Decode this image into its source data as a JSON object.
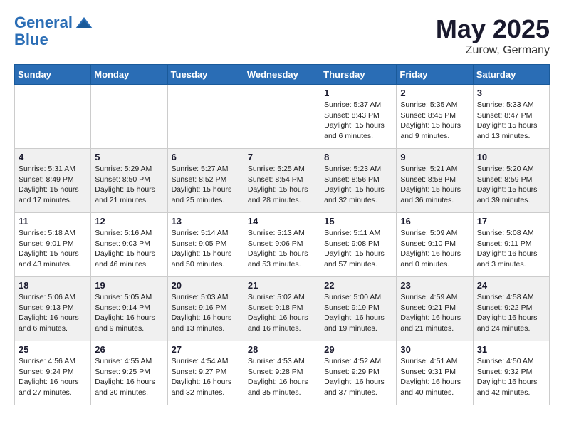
{
  "header": {
    "logo_line1": "General",
    "logo_line2": "Blue",
    "month": "May 2025",
    "location": "Zurow, Germany"
  },
  "weekdays": [
    "Sunday",
    "Monday",
    "Tuesday",
    "Wednesday",
    "Thursday",
    "Friday",
    "Saturday"
  ],
  "weeks": [
    [
      {
        "day": "",
        "info": ""
      },
      {
        "day": "",
        "info": ""
      },
      {
        "day": "",
        "info": ""
      },
      {
        "day": "",
        "info": ""
      },
      {
        "day": "1",
        "info": "Sunrise: 5:37 AM\nSunset: 8:43 PM\nDaylight: 15 hours\nand 6 minutes."
      },
      {
        "day": "2",
        "info": "Sunrise: 5:35 AM\nSunset: 8:45 PM\nDaylight: 15 hours\nand 9 minutes."
      },
      {
        "day": "3",
        "info": "Sunrise: 5:33 AM\nSunset: 8:47 PM\nDaylight: 15 hours\nand 13 minutes."
      }
    ],
    [
      {
        "day": "4",
        "info": "Sunrise: 5:31 AM\nSunset: 8:49 PM\nDaylight: 15 hours\nand 17 minutes."
      },
      {
        "day": "5",
        "info": "Sunrise: 5:29 AM\nSunset: 8:50 PM\nDaylight: 15 hours\nand 21 minutes."
      },
      {
        "day": "6",
        "info": "Sunrise: 5:27 AM\nSunset: 8:52 PM\nDaylight: 15 hours\nand 25 minutes."
      },
      {
        "day": "7",
        "info": "Sunrise: 5:25 AM\nSunset: 8:54 PM\nDaylight: 15 hours\nand 28 minutes."
      },
      {
        "day": "8",
        "info": "Sunrise: 5:23 AM\nSunset: 8:56 PM\nDaylight: 15 hours\nand 32 minutes."
      },
      {
        "day": "9",
        "info": "Sunrise: 5:21 AM\nSunset: 8:58 PM\nDaylight: 15 hours\nand 36 minutes."
      },
      {
        "day": "10",
        "info": "Sunrise: 5:20 AM\nSunset: 8:59 PM\nDaylight: 15 hours\nand 39 minutes."
      }
    ],
    [
      {
        "day": "11",
        "info": "Sunrise: 5:18 AM\nSunset: 9:01 PM\nDaylight: 15 hours\nand 43 minutes."
      },
      {
        "day": "12",
        "info": "Sunrise: 5:16 AM\nSunset: 9:03 PM\nDaylight: 15 hours\nand 46 minutes."
      },
      {
        "day": "13",
        "info": "Sunrise: 5:14 AM\nSunset: 9:05 PM\nDaylight: 15 hours\nand 50 minutes."
      },
      {
        "day": "14",
        "info": "Sunrise: 5:13 AM\nSunset: 9:06 PM\nDaylight: 15 hours\nand 53 minutes."
      },
      {
        "day": "15",
        "info": "Sunrise: 5:11 AM\nSunset: 9:08 PM\nDaylight: 15 hours\nand 57 minutes."
      },
      {
        "day": "16",
        "info": "Sunrise: 5:09 AM\nSunset: 9:10 PM\nDaylight: 16 hours\nand 0 minutes."
      },
      {
        "day": "17",
        "info": "Sunrise: 5:08 AM\nSunset: 9:11 PM\nDaylight: 16 hours\nand 3 minutes."
      }
    ],
    [
      {
        "day": "18",
        "info": "Sunrise: 5:06 AM\nSunset: 9:13 PM\nDaylight: 16 hours\nand 6 minutes."
      },
      {
        "day": "19",
        "info": "Sunrise: 5:05 AM\nSunset: 9:14 PM\nDaylight: 16 hours\nand 9 minutes."
      },
      {
        "day": "20",
        "info": "Sunrise: 5:03 AM\nSunset: 9:16 PM\nDaylight: 16 hours\nand 13 minutes."
      },
      {
        "day": "21",
        "info": "Sunrise: 5:02 AM\nSunset: 9:18 PM\nDaylight: 16 hours\nand 16 minutes."
      },
      {
        "day": "22",
        "info": "Sunrise: 5:00 AM\nSunset: 9:19 PM\nDaylight: 16 hours\nand 19 minutes."
      },
      {
        "day": "23",
        "info": "Sunrise: 4:59 AM\nSunset: 9:21 PM\nDaylight: 16 hours\nand 21 minutes."
      },
      {
        "day": "24",
        "info": "Sunrise: 4:58 AM\nSunset: 9:22 PM\nDaylight: 16 hours\nand 24 minutes."
      }
    ],
    [
      {
        "day": "25",
        "info": "Sunrise: 4:56 AM\nSunset: 9:24 PM\nDaylight: 16 hours\nand 27 minutes."
      },
      {
        "day": "26",
        "info": "Sunrise: 4:55 AM\nSunset: 9:25 PM\nDaylight: 16 hours\nand 30 minutes."
      },
      {
        "day": "27",
        "info": "Sunrise: 4:54 AM\nSunset: 9:27 PM\nDaylight: 16 hours\nand 32 minutes."
      },
      {
        "day": "28",
        "info": "Sunrise: 4:53 AM\nSunset: 9:28 PM\nDaylight: 16 hours\nand 35 minutes."
      },
      {
        "day": "29",
        "info": "Sunrise: 4:52 AM\nSunset: 9:29 PM\nDaylight: 16 hours\nand 37 minutes."
      },
      {
        "day": "30",
        "info": "Sunrise: 4:51 AM\nSunset: 9:31 PM\nDaylight: 16 hours\nand 40 minutes."
      },
      {
        "day": "31",
        "info": "Sunrise: 4:50 AM\nSunset: 9:32 PM\nDaylight: 16 hours\nand 42 minutes."
      }
    ]
  ]
}
